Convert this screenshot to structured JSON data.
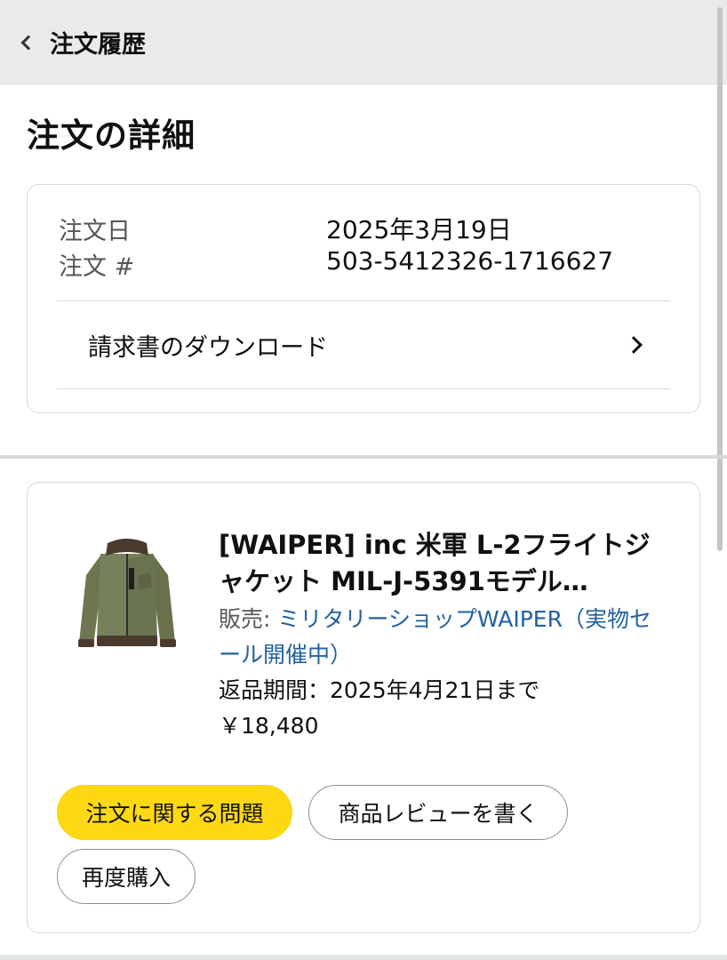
{
  "header": {
    "back_label": "注文履歴"
  },
  "page": {
    "title": "注文の詳細"
  },
  "order": {
    "date_label": "注文日",
    "date_value": "2025年3月19日",
    "number_label": "注文 #",
    "number_value": "503-5412326-1716627",
    "invoice_label": "請求書のダウンロード"
  },
  "item": {
    "title": "[WAIPER] inc 米軍 L-2フライトジャケット MIL-J-5391モデル…",
    "seller_prefix": "販売: ",
    "seller_name": "ミリタリーショップWAIPER（実物セール開催中）",
    "return_text": "返品期間：2025年4月21日まで",
    "price": "￥18,480",
    "image_icon": "flight-jacket-olive"
  },
  "actions": {
    "problem_label": "注文に関する問題",
    "review_label": "商品レビューを書く",
    "rebuy_label": "再度購入"
  },
  "colors": {
    "accent_yellow": "#ffd814",
    "link_blue": "#2162a1",
    "header_bg": "#e9ebeb"
  }
}
